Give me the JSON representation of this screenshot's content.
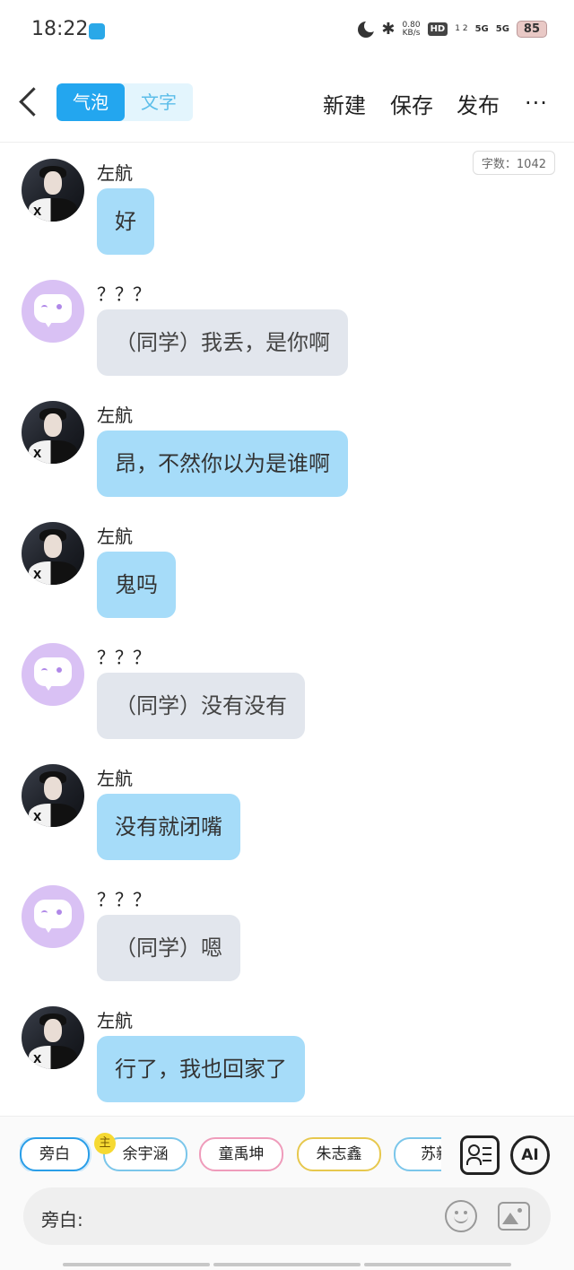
{
  "status_bar": {
    "time": "18:22",
    "speed_value": "0.80",
    "speed_unit": "KB/s",
    "hd": "HD",
    "hd_sub": "1 2",
    "sig1": "5G",
    "sig2": "5G",
    "battery": "85"
  },
  "header": {
    "tab_bubble": "气泡",
    "tab_text": "文字",
    "new_label": "新建",
    "save_label": "保存",
    "publish_label": "发布",
    "more_label": "···"
  },
  "word_count": "字数：1042",
  "messages": [
    {
      "speaker": "左航",
      "text": "好",
      "type": "character"
    },
    {
      "speaker": "？？？",
      "text": "（同学）我丢，是你啊",
      "type": "unknown"
    },
    {
      "speaker": "左航",
      "text": "昂，不然你以为是谁啊",
      "type": "character"
    },
    {
      "speaker": "左航",
      "text": "鬼吗",
      "type": "character"
    },
    {
      "speaker": "？？？",
      "text": "（同学）没有没有",
      "type": "unknown"
    },
    {
      "speaker": "左航",
      "text": "没有就闭嘴",
      "type": "character"
    },
    {
      "speaker": "？？？",
      "text": "（同学）嗯",
      "type": "unknown"
    },
    {
      "speaker": "左航",
      "text": "行了，我也回家了",
      "type": "character"
    }
  ],
  "characters": [
    {
      "name": "旁白",
      "selected": true
    },
    {
      "name": "余宇涵",
      "badge": "主"
    },
    {
      "name": "童禹坤"
    },
    {
      "name": "朱志鑫"
    },
    {
      "name": "苏新"
    }
  ],
  "input": {
    "label": "旁白:"
  },
  "icons": {
    "contact": "contact-card-icon",
    "ai": "AI",
    "emoji": "emoji-icon",
    "image": "image-icon"
  },
  "colors": {
    "accent": "#23a6ef",
    "bubble_blue": "#a6dcf9",
    "bubble_grey": "#e2e6ed",
    "ghost_avatar": "#d9c1f4"
  }
}
